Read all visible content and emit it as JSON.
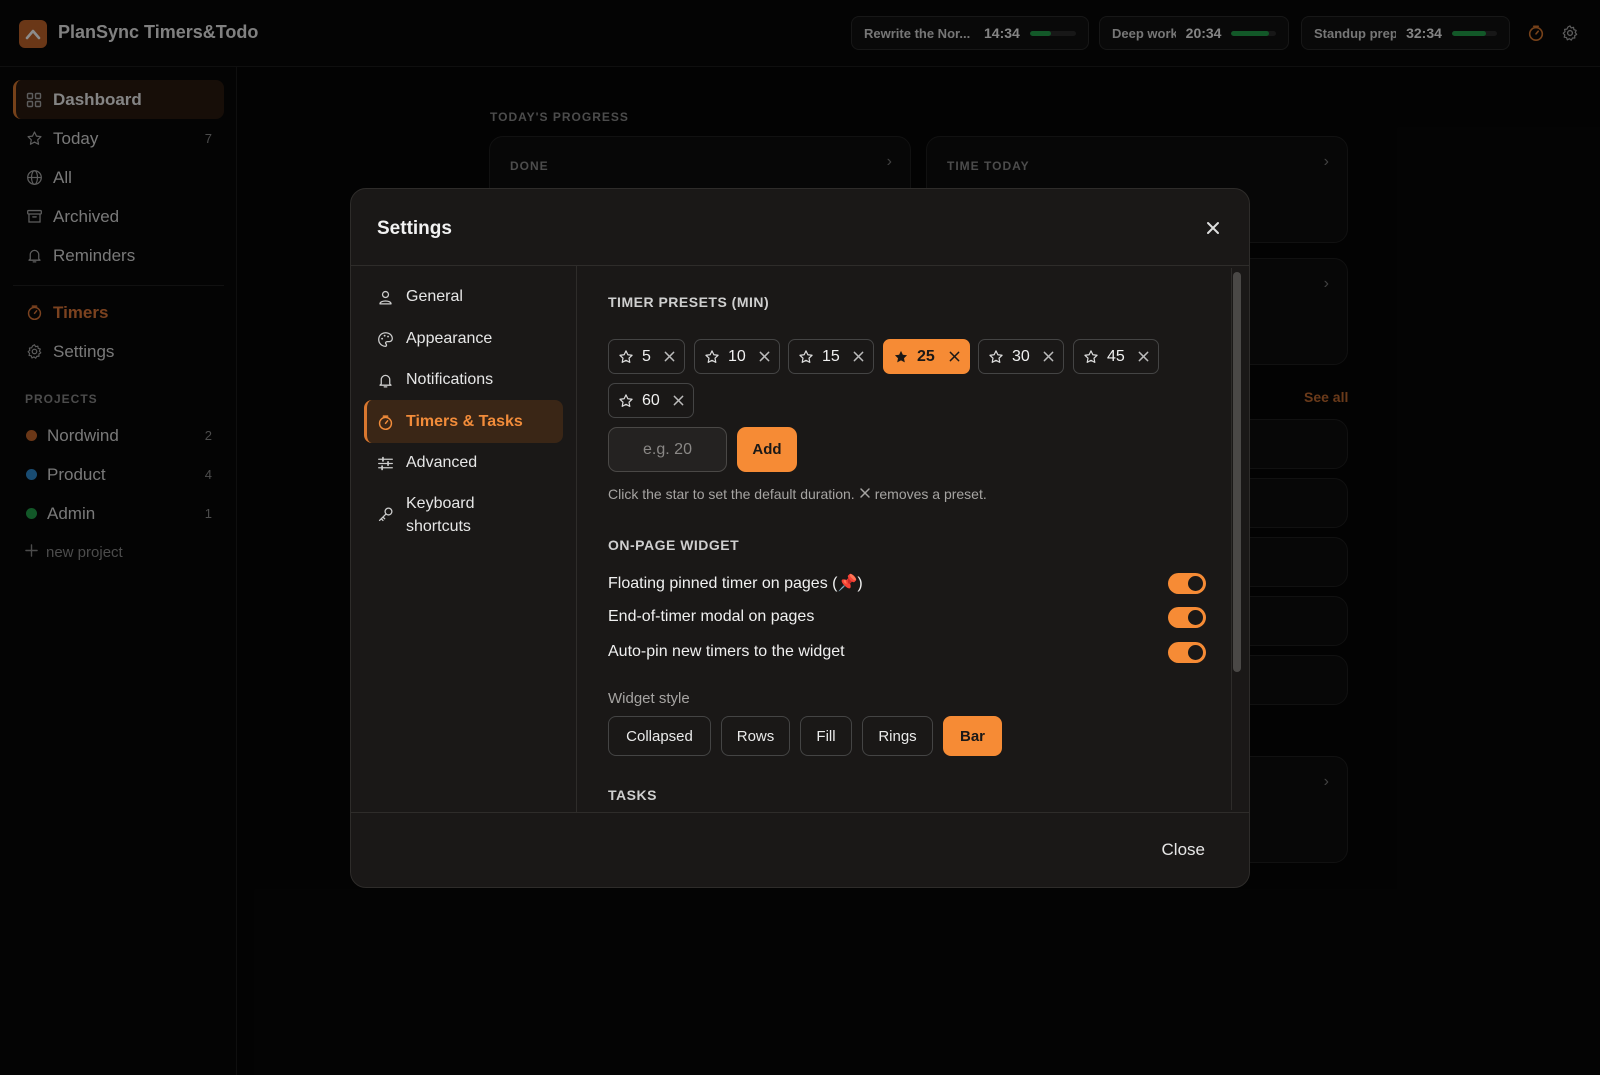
{
  "app": {
    "title": "PlanSync Timers&Todo"
  },
  "timers": [
    {
      "name": "Rewrite the Nor...",
      "time": "14:34",
      "progress": 0.45
    },
    {
      "name": "Deep work",
      "time": "20:34",
      "progress": 0.85
    },
    {
      "name": "Standup prep",
      "time": "32:34",
      "progress": 0.75
    }
  ],
  "sidebar": {
    "items": [
      {
        "label": "Dashboard",
        "icon": "grid-icon",
        "count": ""
      },
      {
        "label": "Today",
        "icon": "star-icon",
        "count": "7"
      },
      {
        "label": "All",
        "icon": "globe-icon",
        "count": ""
      },
      {
        "label": "Archived",
        "icon": "archive-icon",
        "count": ""
      },
      {
        "label": "Reminders",
        "icon": "bell-icon",
        "count": ""
      }
    ],
    "timers_label": "Timers",
    "settings_label": "Settings",
    "projects_heading": "PROJECTS",
    "projects": [
      {
        "label": "Nordwind",
        "count": "2",
        "color": "#c2642a"
      },
      {
        "label": "Product",
        "count": "4",
        "color": "#2f8ad0"
      },
      {
        "label": "Admin",
        "count": "1",
        "color": "#22a04a"
      }
    ],
    "new_project": "new project"
  },
  "dashboard": {
    "heading": "TODAY'S PROGRESS",
    "card_done": "DONE",
    "card_time": "TIME TODAY",
    "see_all": "See all"
  },
  "modal": {
    "title": "Settings",
    "nav": [
      {
        "label": "General",
        "icon": "user-icon"
      },
      {
        "label": "Appearance",
        "icon": "palette-icon"
      },
      {
        "label": "Notifications",
        "icon": "bell-icon"
      },
      {
        "label": "Timers & Tasks",
        "icon": "timer-icon"
      },
      {
        "label": "Advanced",
        "icon": "sliders-icon"
      },
      {
        "label": "Keyboard shortcuts",
        "icon": "key-icon"
      }
    ],
    "active_nav": "Timers & Tasks",
    "presets_heading": "TIMER PRESETS (MIN)",
    "presets": [
      "5",
      "10",
      "15",
      "25",
      "30",
      "45",
      "60"
    ],
    "default_preset": "25",
    "add_placeholder": "e.g. 20",
    "add_label": "Add",
    "hint_part1": "Click the star to set the default duration.",
    "hint_part2": "removes a preset.",
    "widget_heading": "ON-PAGE WIDGET",
    "toggles": [
      {
        "label": "Floating pinned timer on pages (📌)",
        "on": true
      },
      {
        "label": "End-of-timer modal on pages",
        "on": true
      },
      {
        "label": "Auto-pin new timers to the widget",
        "on": true
      }
    ],
    "widget_style_label": "Widget style",
    "widget_styles": [
      "Collapsed",
      "Rows",
      "Fill",
      "Rings",
      "Bar"
    ],
    "selected_style": "Bar",
    "tasks_heading": "TASKS",
    "close_label": "Close"
  },
  "colors": {
    "accent": "#f68b35",
    "progress": "#22a04a"
  }
}
